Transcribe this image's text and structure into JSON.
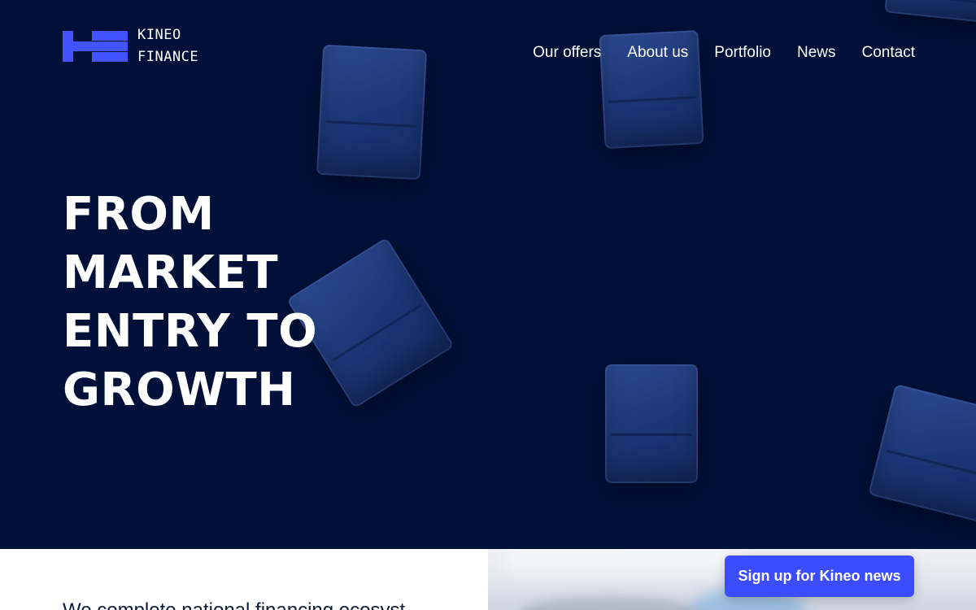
{
  "brand": {
    "line1": "KINEO",
    "line2": "FINANCE",
    "accent_color": "#4152ff",
    "hero_background": "#001038"
  },
  "nav": {
    "items": [
      {
        "label": "Our offers"
      },
      {
        "label": "About us"
      },
      {
        "label": "Portfolio"
      },
      {
        "label": "News"
      },
      {
        "label": "Contact"
      }
    ]
  },
  "hero": {
    "headline_lines": [
      "FROM MARKET",
      "ENTRY TO",
      "GROWTH"
    ]
  },
  "intro": {
    "text": "We complete national financing ecosyst"
  },
  "cta": {
    "signup_label": "Sign up for Kineo news",
    "color": "#3c4cff"
  }
}
